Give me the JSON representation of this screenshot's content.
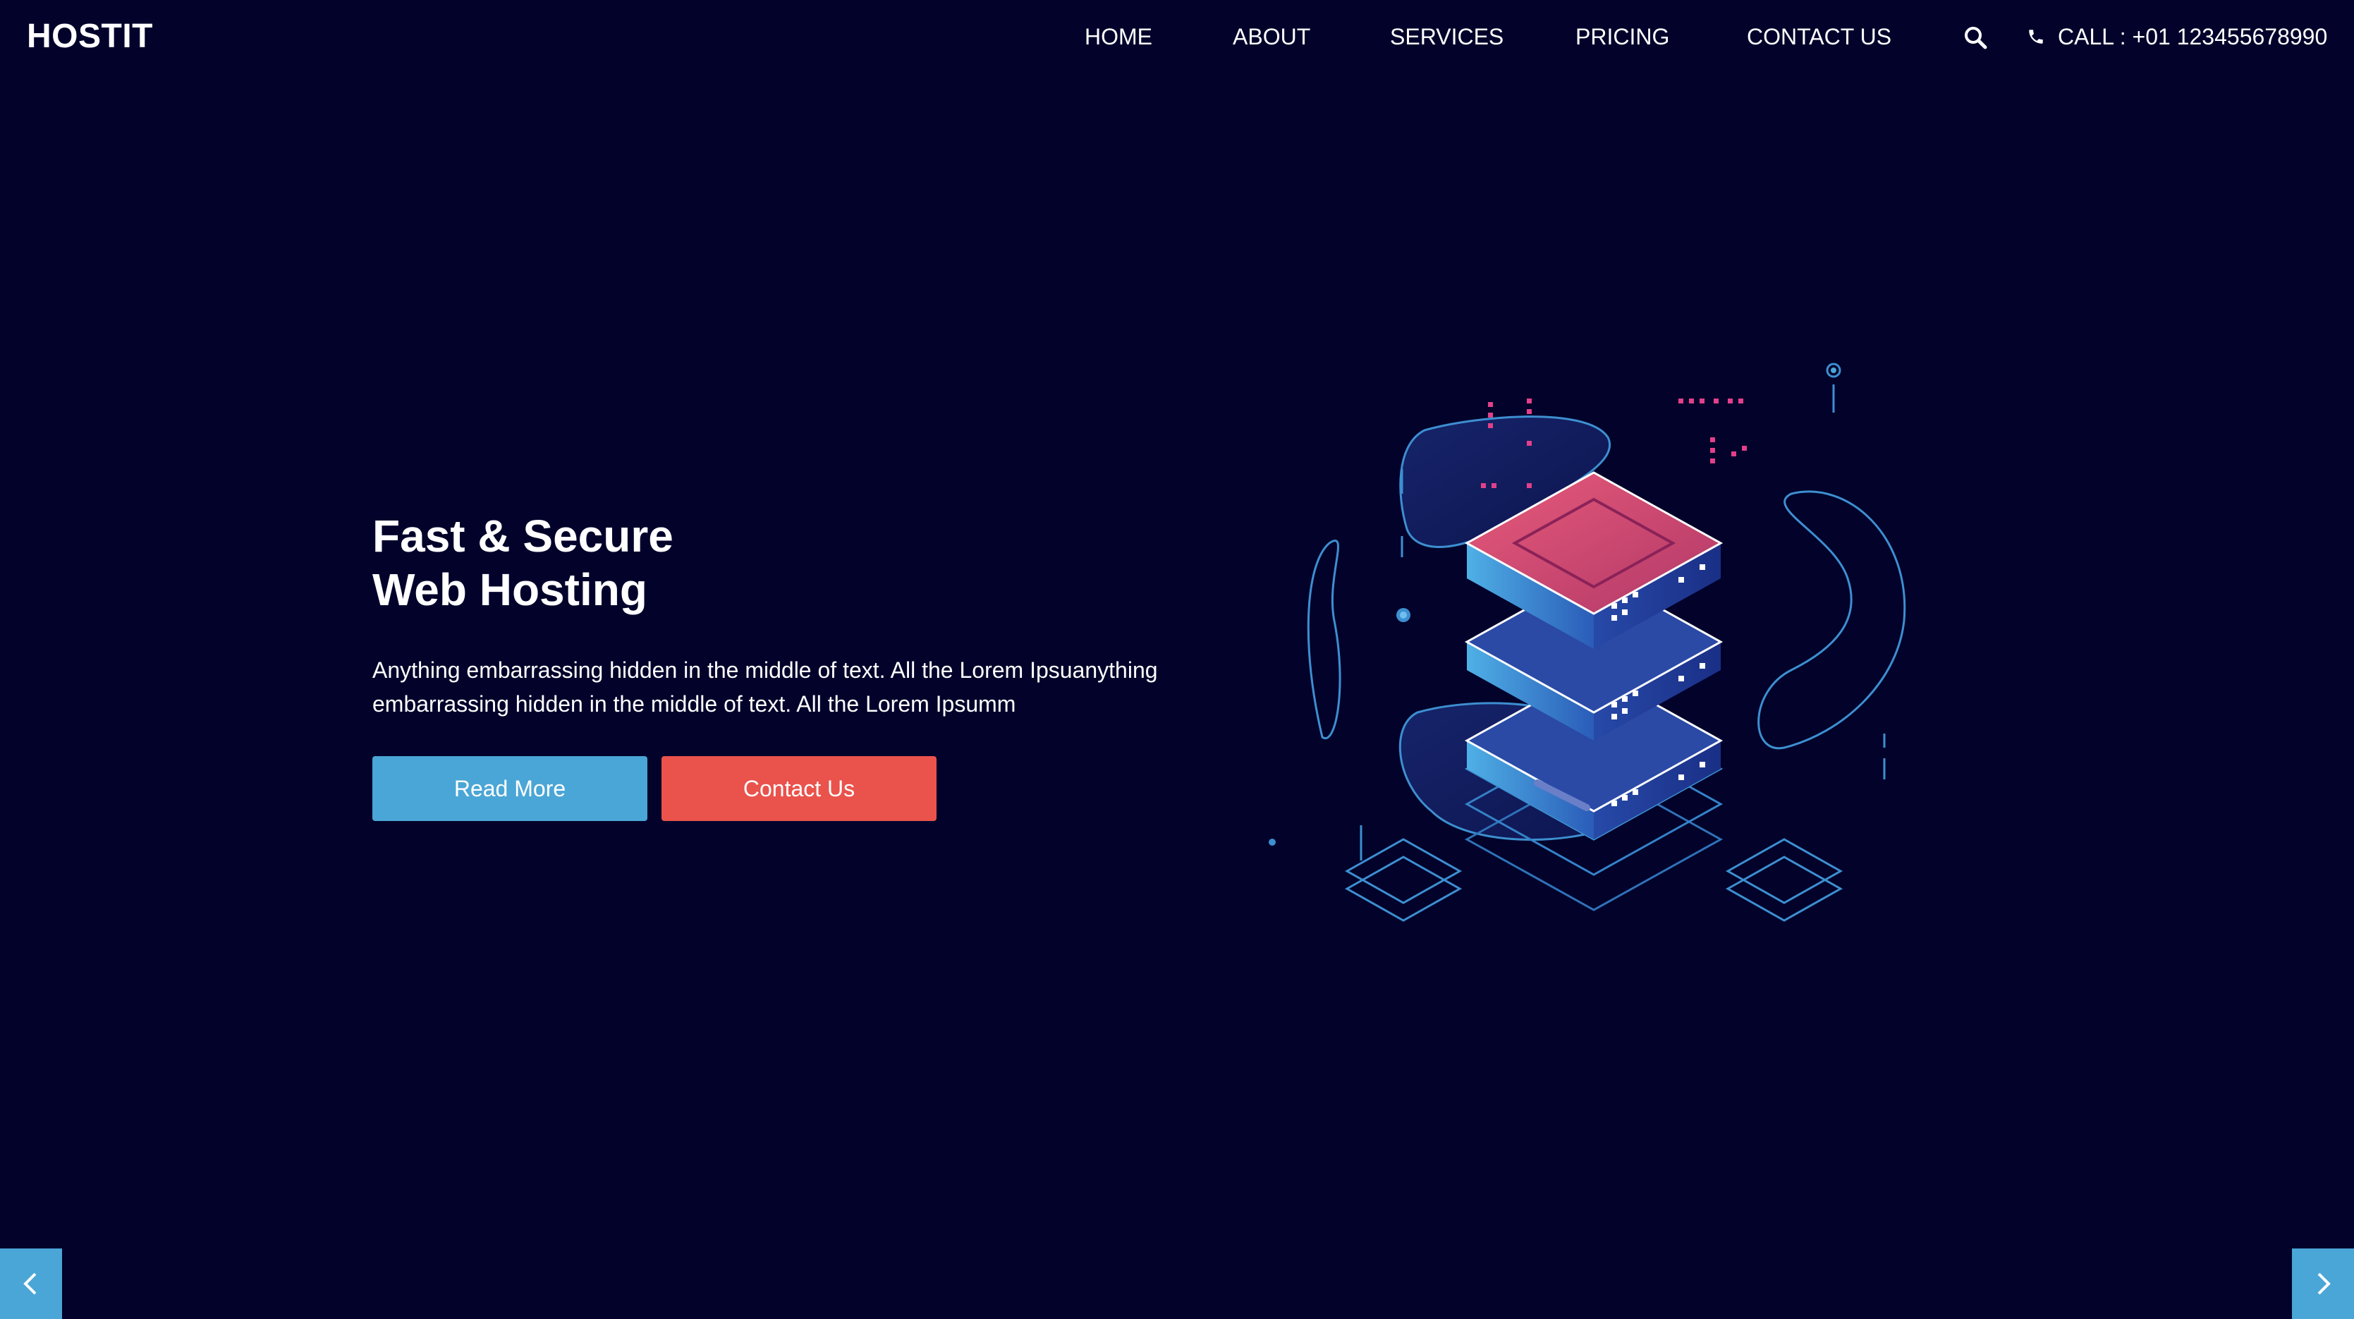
{
  "header": {
    "brand": "HOSTIT",
    "nav": [
      {
        "label": "HOME"
      },
      {
        "label": "ABOUT"
      },
      {
        "label": "SERVICES"
      },
      {
        "label": "PRICING"
      },
      {
        "label": "CONTACT US"
      }
    ],
    "search_icon": "search-icon",
    "phone_icon": "phone-icon",
    "call_text": "CALL : +01 123455678990"
  },
  "hero": {
    "title_line1": "Fast & Secure",
    "title_line2": "Web Hosting",
    "description": "Anything embarrassing hidden in the middle of text. All the Lorem Ipsuanything embarrassing hidden in the middle of text. All the Lorem Ipsumm",
    "read_more_label": "Read More",
    "contact_label": "Contact Us",
    "illustration": "server-stack-illustration"
  },
  "slider": {
    "prev_icon": "chevron-left-icon",
    "next_icon": "chevron-right-icon"
  },
  "colors": {
    "background": "#02022b",
    "accent_blue": "#4aa6d6",
    "accent_red": "#e9534c",
    "text": "#ffffff"
  }
}
